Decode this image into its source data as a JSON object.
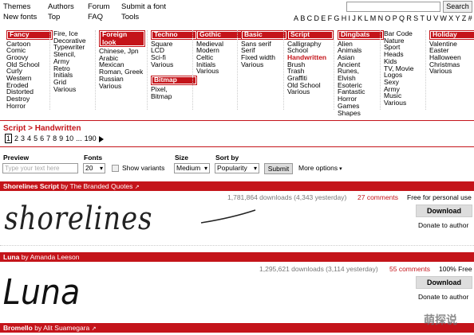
{
  "nav": {
    "col1": [
      "Themes",
      "New fonts"
    ],
    "col2": [
      "Authors",
      "Top"
    ],
    "col3": [
      "Forum",
      "FAQ"
    ],
    "col4": [
      "Submit a font",
      "Tools"
    ],
    "search_button": "Search",
    "alphabet": [
      "A",
      "B",
      "C",
      "D",
      "E",
      "F",
      "G",
      "H",
      "I",
      "J",
      "K",
      "L",
      "M",
      "N",
      "O",
      "P",
      "Q",
      "R",
      "S",
      "T",
      "U",
      "V",
      "W",
      "X",
      "Y",
      "Z",
      "#"
    ]
  },
  "categories": [
    {
      "name": "Fancy",
      "items": [
        "Cartoon",
        "Comic",
        "Groovy",
        "Old School",
        "Curly",
        "Western",
        "Eroded",
        "Distorted",
        "Destroy",
        "Horror"
      ]
    },
    {
      "name": "",
      "items": [
        "Fire, Ice",
        "Decorative",
        "Typewriter",
        "Stencil,",
        "Army",
        "Retro",
        "Initials",
        "Grid",
        "Various"
      ]
    },
    {
      "name": "Foreign look",
      "items": [
        "Chinese, Jpn",
        "Arabic",
        "Mexican",
        "Roman, Greek",
        "Russian",
        "Various"
      ]
    },
    {
      "name": "Techno",
      "items": [
        "Square",
        "LCD",
        "Sci-fi",
        "Various"
      ],
      "name2": "Bitmap",
      "items2": [
        "Pixel,",
        "Bitmap"
      ]
    },
    {
      "name": "Gothic",
      "items": [
        "Medieval",
        "Modern",
        "Celtic",
        "Initials",
        "Various"
      ]
    },
    {
      "name": "Basic",
      "items": [
        "Sans serif",
        "Serif",
        "Fixed width",
        "Various"
      ]
    },
    {
      "name": "Script",
      "items": [
        "Calligraphy",
        "School",
        "Handwritten",
        "Brush",
        "Trash",
        "Graffiti",
        "Old School",
        "Various"
      ],
      "active": "Handwritten"
    },
    {
      "name": "Dingbats",
      "items": [
        "Alien",
        "Animals",
        "Asian",
        "Ancient",
        "Runes,",
        "Elvish",
        "Esoteric",
        "Fantastic",
        "Horror",
        "Games",
        "Shapes"
      ]
    },
    {
      "name": "",
      "items": [
        "Bar Code",
        "Nature",
        "Sport",
        "Heads",
        "Kids",
        "TV, Movie",
        "Logos",
        "Sexy",
        "Army",
        "Music",
        "Various"
      ]
    },
    {
      "name": "Holiday",
      "items": [
        "Valentine",
        "Easter",
        "Halloween",
        "Christmas",
        "Various"
      ]
    }
  ],
  "breadcrumb": "Script > Handwritten",
  "pager": {
    "pages": [
      "1",
      "2",
      "3",
      "4",
      "5",
      "6",
      "7",
      "8",
      "9",
      "10",
      "...",
      "190"
    ],
    "current": "1"
  },
  "filters": {
    "preview_label": "Preview",
    "preview_placeholder": "Type your text here",
    "fonts_label": "Fonts",
    "fonts_value": "20",
    "show_variants": "Show variants",
    "size_label": "Size",
    "size_value": "Medium",
    "sort_label": "Sort by",
    "sort_value": "Popularity",
    "submit": "Submit",
    "more": "More options"
  },
  "fonts": [
    {
      "name": "Shorelines Script",
      "by": "by",
      "author": "The Branded Quotes",
      "downloads": "1,781,864 downloads (4,343 yesterday)",
      "comments": "27 comments",
      "license": "Free for personal use",
      "download": "Download",
      "donate": "Donate to author",
      "preview": "shorelines"
    },
    {
      "name": "Luna",
      "by": "by",
      "author": "Amanda Leeson",
      "downloads": "1,295,621 downloads (3,114 yesterday)",
      "comments": "55 comments",
      "license": "100% Free",
      "download": "Download",
      "donate": "Donate to author",
      "preview": "Luna"
    },
    {
      "name": "Bromello",
      "by": "by",
      "author": "Alit Suamegara",
      "downloads": "",
      "comments": "",
      "license": "",
      "download": "",
      "donate": "",
      "preview": ""
    }
  ],
  "watermark": "萌探说",
  "colors": {
    "accent": "#c4141a"
  }
}
